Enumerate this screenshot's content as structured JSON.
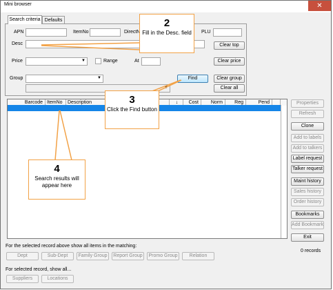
{
  "window": {
    "title": "Mini browser",
    "close_glyph": "✕"
  },
  "tabs": [
    "Search criteria",
    "Defaults"
  ],
  "fields": {
    "apn": "APN",
    "itemno": "ItemNo",
    "directn": "DirectN",
    "plu": "PLU",
    "desc": "Desc",
    "price": "Price",
    "range": "Range",
    "at": "At",
    "group": "Group"
  },
  "buttons": {
    "clear_top": "Clear top",
    "clear_price": "Clear price",
    "find": "Find",
    "clear_group": "Clear group",
    "clear_all": "Clear all"
  },
  "columns": [
    "Barcode",
    "ItemNo",
    "Description",
    "Cost",
    "Norm",
    "Reg",
    "Pend"
  ],
  "sort_arrow": "↓",
  "side_buttons": [
    {
      "label": "Properties",
      "enabled": false
    },
    {
      "label": "Refresh",
      "enabled": false
    },
    {
      "label": "Clone",
      "enabled": true
    },
    {
      "label": "Add to labels",
      "enabled": false
    },
    {
      "label": "Add to talkers",
      "enabled": false
    },
    {
      "label": "Label request",
      "enabled": true
    },
    {
      "label": "Talker request",
      "enabled": true
    },
    {
      "label": "Maint history",
      "enabled": true
    },
    {
      "label": "Sales history",
      "enabled": false
    },
    {
      "label": "Order history",
      "enabled": false
    },
    {
      "label": "Bookmarks",
      "enabled": true
    },
    {
      "label": "Add Bookmark",
      "enabled": false
    },
    {
      "label": "Exit",
      "enabled": true
    }
  ],
  "records": "0 records",
  "matching_label": "For the selected record above show all items in the matching:",
  "matching_buttons": [
    "Dept",
    "Sub-Dept",
    "Family Group",
    "Report Group",
    "Promo Group",
    "Relation"
  ],
  "show_all_label": "For selected record, show all...",
  "show_all_buttons": [
    "Suppliers",
    "Locations"
  ],
  "callouts": [
    {
      "num": "2",
      "text": "Fill in the Desc. field"
    },
    {
      "num": "3",
      "text": "Click the Find button"
    },
    {
      "num": "4",
      "text": "Search results will appear here"
    }
  ],
  "colors": {
    "accent_orange": "#f2a145",
    "selection_blue": "#1585e8",
    "close_red": "#c7503d"
  }
}
